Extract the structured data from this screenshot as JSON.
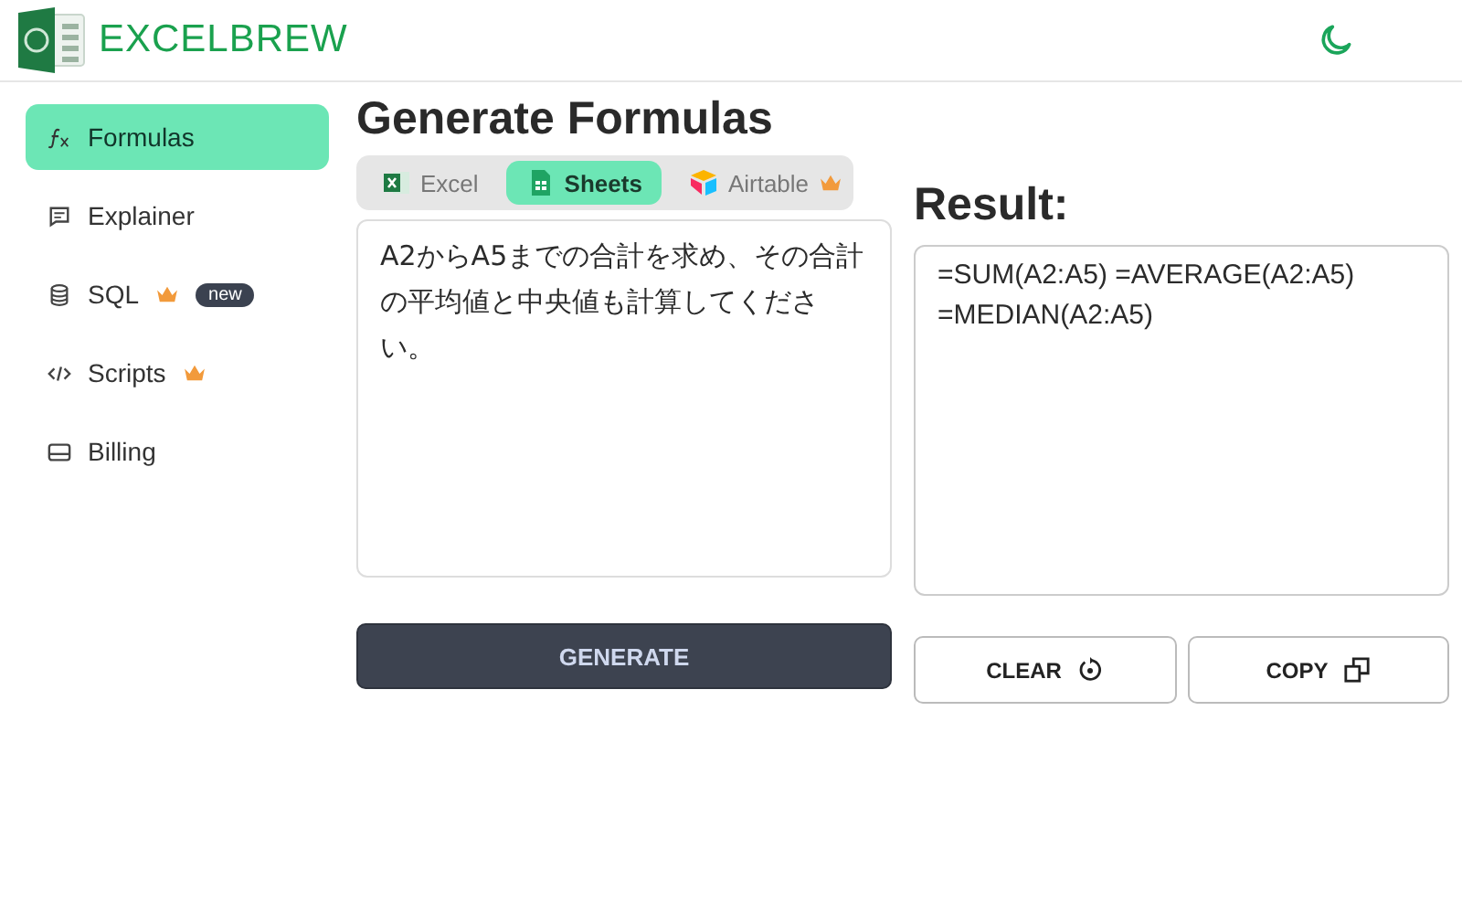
{
  "brand": {
    "name": "EXCELBREW"
  },
  "sidebar": {
    "items": [
      {
        "label": "Formulas",
        "kind": "function",
        "selected": true,
        "premium": false
      },
      {
        "label": "Explainer",
        "kind": "message",
        "selected": false,
        "premium": false
      },
      {
        "label": "SQL",
        "kind": "database",
        "selected": false,
        "premium": true,
        "badge": "new"
      },
      {
        "label": "Scripts",
        "kind": "code",
        "selected": false,
        "premium": true
      },
      {
        "label": "Billing",
        "kind": "card",
        "selected": false,
        "premium": false
      }
    ]
  },
  "main": {
    "title": "Generate Formulas",
    "tabs": [
      {
        "label": "Excel",
        "kind": "excel",
        "selected": false,
        "premium": false
      },
      {
        "label": "Sheets",
        "kind": "sheets",
        "selected": true,
        "premium": false
      },
      {
        "label": "Airtable",
        "kind": "airtable",
        "selected": false,
        "premium": true
      }
    ],
    "prompt": "A2からA5までの合計を求め、その合計の平均値と中央値も計算してください。",
    "generate_button": "GENERATE"
  },
  "result": {
    "title": "Result:",
    "value": "=SUM(A2:A5) =AVERAGE(A2:A5) =MEDIAN(A2:A5)",
    "clear_button": "CLEAR",
    "copy_button": "COPY"
  }
}
